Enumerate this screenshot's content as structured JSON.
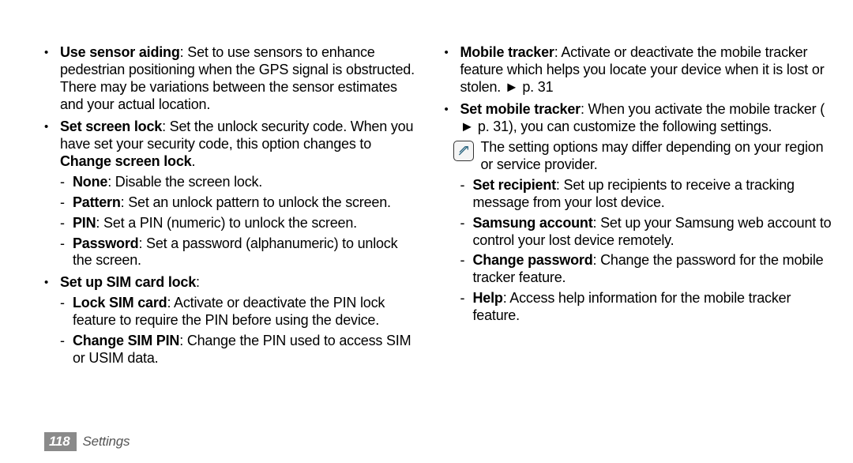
{
  "footer": {
    "page_number": "118",
    "section": "Settings"
  },
  "glyphs": {
    "bullet": "•",
    "dash": "-",
    "triangle": "►"
  },
  "note_icon": "note-icon",
  "left_column": {
    "items": [
      {
        "bold": "Use sensor aiding",
        "rest": ": Set to use sensors to enhance pedestrian positioning when the GPS signal is obstructed. There may be variations between the sensor estimates and your actual location."
      },
      {
        "bold": "Set screen lock",
        "rest": ": Set the unlock security code. When you have set your security code, this option changes to ",
        "bold2": "Change screen lock",
        "rest2": ".",
        "sub": [
          {
            "bold": "None",
            "rest": ": Disable the screen lock."
          },
          {
            "bold": "Pattern",
            "rest": ": Set an unlock pattern to unlock the screen."
          },
          {
            "bold": "PIN",
            "rest": ": Set a PIN (numeric) to unlock the screen."
          },
          {
            "bold": "Password",
            "rest": ": Set a password (alphanumeric) to unlock the screen."
          }
        ]
      },
      {
        "bold": "Set up SIM card lock",
        "rest": ":",
        "sub": [
          {
            "bold": "Lock SIM card",
            "rest": ": Activate or deactivate the PIN lock feature to require the PIN before using the device."
          },
          {
            "bold": "Change SIM PIN",
            "rest": ": Change the PIN used to access SIM or USIM data."
          }
        ]
      }
    ]
  },
  "right_column": {
    "items": [
      {
        "bold": "Mobile tracker",
        "rest": ": Activate or deactivate the mobile tracker feature which helps you locate your device when it is lost or stolen. ",
        "tri": true,
        "rest2": "p. 31"
      },
      {
        "bold": "Set mobile tracker",
        "rest": ": When you activate the mobile tracker (",
        "tri_inline": true,
        "rest_inline": " p. 31), you can customize the following settings."
      }
    ],
    "note": "The setting options may differ depending on your region or service provider.",
    "sub": [
      {
        "bold": "Set recipient",
        "rest": ": Set up recipients to receive a tracking message from your lost device."
      },
      {
        "bold": "Samsung account",
        "rest": ": Set up your Samsung web account to control your lost device remotely."
      },
      {
        "bold": "Change password",
        "rest": ": Change the password for the mobile tracker feature."
      },
      {
        "bold": "Help",
        "rest": ": Access help information for the mobile tracker feature."
      }
    ]
  }
}
